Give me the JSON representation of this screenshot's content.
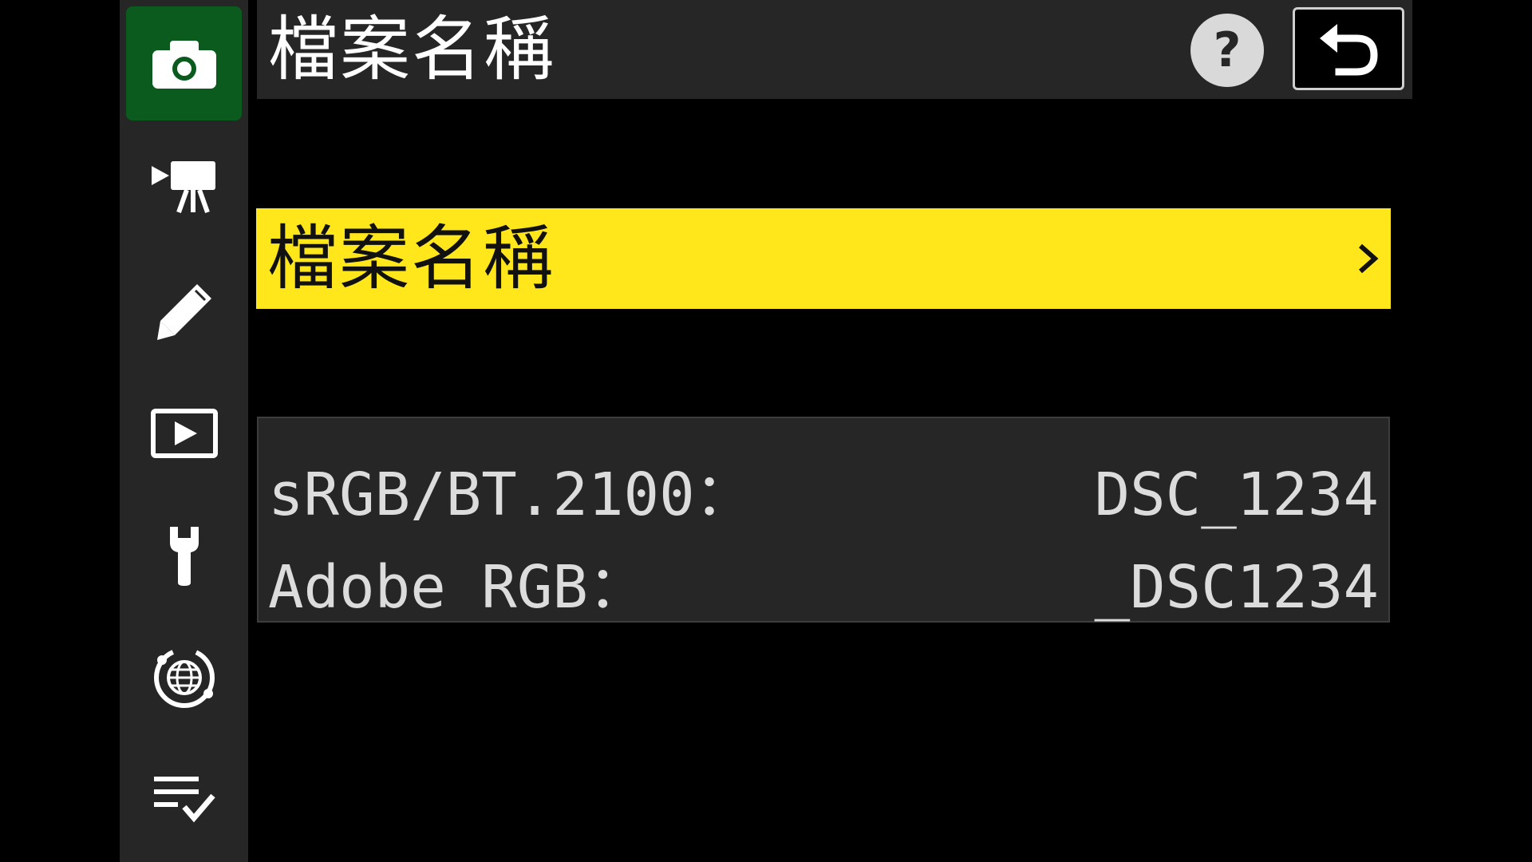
{
  "header": {
    "title": "檔案名稱",
    "help_label": "?",
    "help_icon": "help-icon",
    "back_icon": "return-arrow-icon"
  },
  "sidebar": {
    "items": [
      {
        "name": "photo-shooting-menu",
        "icon": "camera-icon",
        "active": true
      },
      {
        "name": "video-recording-menu",
        "icon": "movie-camera-icon",
        "active": false
      },
      {
        "name": "custom-settings-menu",
        "icon": "pencil-icon",
        "active": false
      },
      {
        "name": "playback-menu",
        "icon": "play-icon",
        "active": false
      },
      {
        "name": "setup-menu",
        "icon": "wrench-icon",
        "active": false
      },
      {
        "name": "network-menu",
        "icon": "globe-network-icon",
        "active": false
      },
      {
        "name": "my-menu",
        "icon": "checklist-icon",
        "active": false
      }
    ]
  },
  "menu": {
    "selected_item": {
      "label": "檔案名稱",
      "icon": "chevron-right-icon"
    }
  },
  "info": {
    "rows": [
      {
        "label": "sRGB/BT.2100：",
        "value": "DSC_1234"
      },
      {
        "label": "Adobe RGB：",
        "value": "_DSC1234"
      }
    ]
  },
  "colors": {
    "background": "#000000",
    "panel": "#262626",
    "active_tab": "#0a5b1d",
    "highlight": "#ffe71c",
    "text": "#ffffff"
  }
}
